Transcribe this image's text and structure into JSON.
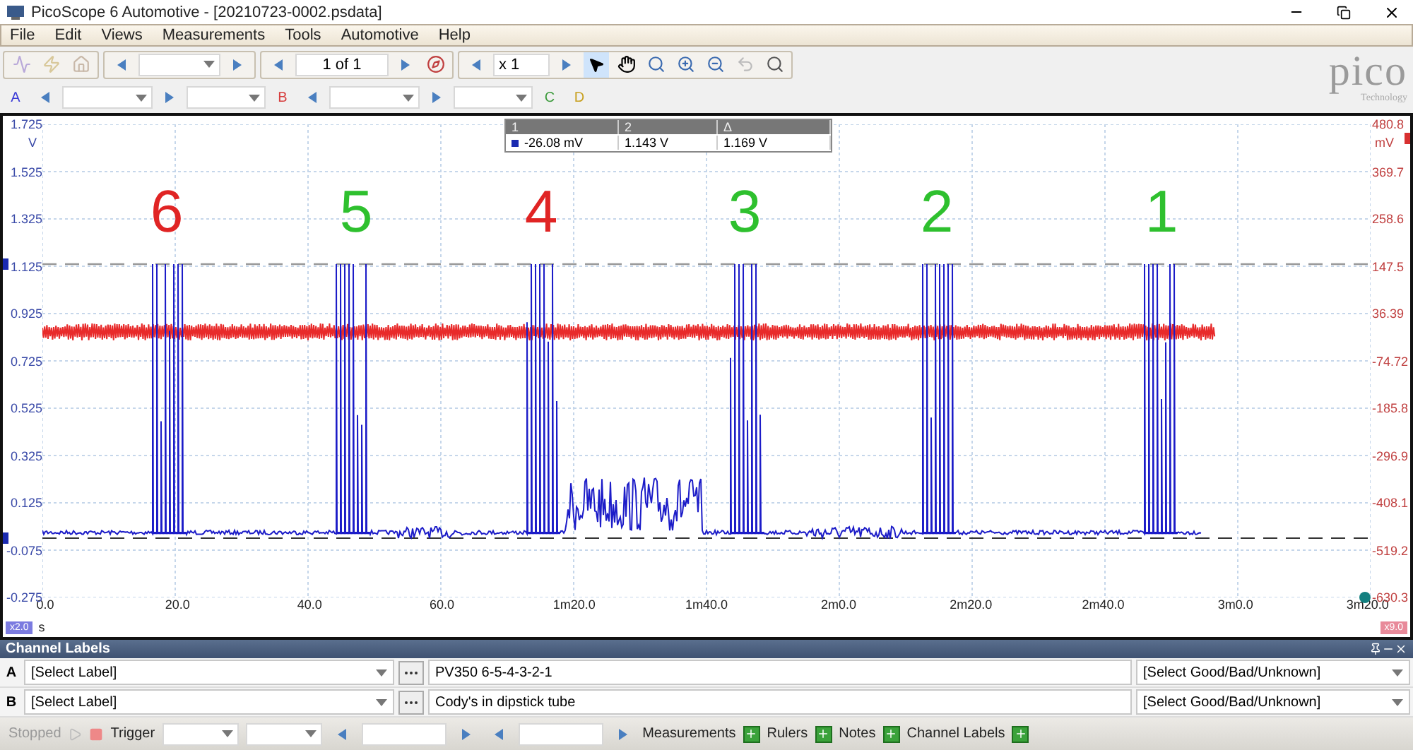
{
  "window": {
    "title": "PicoScope 6 Automotive - [20210723-0002.psdata]"
  },
  "menu": [
    {
      "label": "File"
    },
    {
      "label": "Edit"
    },
    {
      "label": "Views"
    },
    {
      "label": "Measurements"
    },
    {
      "label": "Tools"
    },
    {
      "label": "Automotive"
    },
    {
      "label": "Help"
    }
  ],
  "toolbar": {
    "page_field": "1 of 1",
    "zoom_field": "x 1"
  },
  "channels": [
    {
      "letter": "A",
      "color": "#3b3bd6"
    },
    {
      "letter": "B",
      "color": "#d63b3b"
    },
    {
      "letter": "C",
      "color": "#3a9a3a"
    },
    {
      "letter": "D",
      "color": "#c8a020"
    }
  ],
  "logo": {
    "name": "pico",
    "tagline": "Technology"
  },
  "plot": {
    "left_axis": {
      "unit": "V",
      "ticks": [
        "1.725",
        "1.525",
        "1.325",
        "1.125",
        "0.925",
        "0.725",
        "0.525",
        "0.325",
        "0.125",
        "-0.075",
        "-0.275"
      ]
    },
    "right_axis": {
      "unit": "mV",
      "ticks": [
        "480.8",
        "369.7",
        "258.6",
        "147.5",
        "36.39",
        "-74.72",
        "-185.8",
        "-296.9",
        "-408.1",
        "-519.2",
        "-630.3"
      ]
    },
    "x_axis": {
      "unit": "s",
      "ticks": [
        "0.0",
        "20.0",
        "40.0",
        "60.0",
        "1m20.0",
        "1m40.0",
        "2m0.0",
        "2m20.0",
        "2m40.0",
        "3m0.0",
        "3m20.0"
      ]
    },
    "left_badge": "x2.0",
    "right_badge": "x9.0",
    "burst_labels": [
      {
        "label": "6",
        "color": "#e02424"
      },
      {
        "label": "5",
        "color": "#2ec02e"
      },
      {
        "label": "4",
        "color": "#e02424"
      },
      {
        "label": "3",
        "color": "#2ec02e"
      },
      {
        "label": "2",
        "color": "#2ec02e"
      },
      {
        "label": "1",
        "color": "#2ec02e"
      }
    ],
    "measurement_table": {
      "columns": [
        "1",
        "2",
        "Δ"
      ],
      "values": [
        "-26.08 mV",
        "1.143 V",
        "1.169 V"
      ]
    }
  },
  "channel_labels": {
    "title": "Channel Labels",
    "rows": [
      {
        "channel": "A",
        "label": "[Select Label]",
        "note": "PV350 6-5-4-3-2-1",
        "rating": "[Select Good/Bad/Unknown]"
      },
      {
        "channel": "B",
        "label": "[Select Label]",
        "note": "Cody's in dipstick tube",
        "rating": "[Select Good/Bad/Unknown]"
      }
    ]
  },
  "status_bar": {
    "state": "Stopped",
    "trigger": "Trigger",
    "items": [
      "Measurements",
      "Rulers",
      "Notes",
      "Channel Labels"
    ]
  }
}
